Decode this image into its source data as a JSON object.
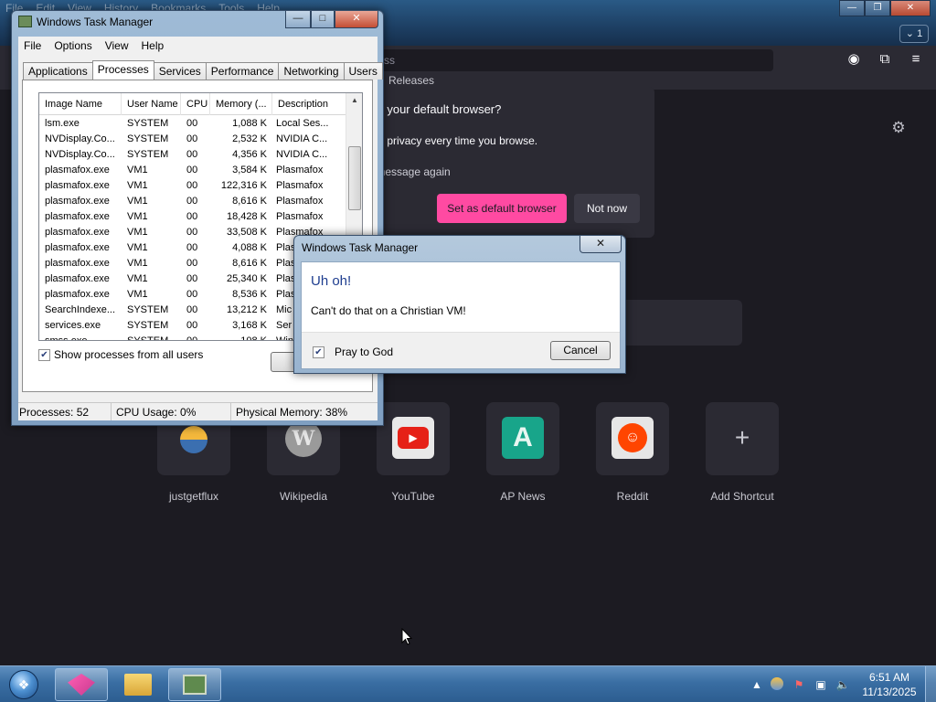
{
  "browser": {
    "menu": [
      "File",
      "Edit",
      "View",
      "History",
      "Bookmarks",
      "Tools",
      "Help"
    ],
    "tab_count": "1",
    "url_placeholder": "ss",
    "bookmark_releases": "Releases",
    "default_prompt": {
      "title": "ox your default browser?",
      "body": "and privacy every time you browse.",
      "dont_show": "s message again",
      "set_default_label": "Set as default browser",
      "not_now_label": "Not now"
    },
    "shortcuts": [
      {
        "label": "justgetflux",
        "icon": "flux-logo"
      },
      {
        "label": "Wikipedia",
        "icon": "wikipedia-globe"
      },
      {
        "label": "YouTube",
        "icon": "youtube-logo"
      },
      {
        "label": "AP News",
        "icon": "apnews-logo"
      },
      {
        "label": "Reddit",
        "icon": "reddit-logo"
      },
      {
        "label": "Add Shortcut",
        "icon": "plus-icon"
      }
    ],
    "accent_color": "#ff4aa2"
  },
  "taskmgr": {
    "title": "Windows Task Manager",
    "menu": [
      "File",
      "Options",
      "View",
      "Help"
    ],
    "tabs": [
      "Applications",
      "Processes",
      "Services",
      "Performance",
      "Networking",
      "Users"
    ],
    "active_tab": "Processes",
    "columns": [
      "Image Name",
      "User Name",
      "CPU",
      "Memory (...",
      "Description"
    ],
    "rows": [
      [
        "lsm.exe",
        "SYSTEM",
        "00",
        "1,088 K",
        "Local Ses..."
      ],
      [
        "NVDisplay.Co...",
        "SYSTEM",
        "00",
        "2,532 K",
        "NVIDIA C..."
      ],
      [
        "NVDisplay.Co...",
        "SYSTEM",
        "00",
        "4,356 K",
        "NVIDIA C..."
      ],
      [
        "plasmafox.exe",
        "VM1",
        "00",
        "3,584 K",
        "Plasmafox"
      ],
      [
        "plasmafox.exe",
        "VM1",
        "00",
        "122,316 K",
        "Plasmafox"
      ],
      [
        "plasmafox.exe",
        "VM1",
        "00",
        "8,616 K",
        "Plasmafox"
      ],
      [
        "plasmafox.exe",
        "VM1",
        "00",
        "18,428 K",
        "Plasmafox"
      ],
      [
        "plasmafox.exe",
        "VM1",
        "00",
        "33,508 K",
        "Plasmafox"
      ],
      [
        "plasmafox.exe",
        "VM1",
        "00",
        "4,088 K",
        "Plas"
      ],
      [
        "plasmafox.exe",
        "VM1",
        "00",
        "8,616 K",
        "Plas"
      ],
      [
        "plasmafox.exe",
        "VM1",
        "00",
        "25,340 K",
        "Plas"
      ],
      [
        "plasmafox.exe",
        "VM1",
        "00",
        "8,536 K",
        "Plas"
      ],
      [
        "SearchIndexe...",
        "SYSTEM",
        "00",
        "13,212 K",
        "Mic"
      ],
      [
        "services.exe",
        "SYSTEM",
        "00",
        "3,168 K",
        "Ser"
      ],
      [
        "smss.exe",
        "SYSTEM",
        "00",
        "108 K",
        "Win"
      ]
    ],
    "show_all_label": "Show processes from all users",
    "show_all_checked": true,
    "end_process_label": "En",
    "status": {
      "processes": "Processes: 52",
      "cpu": "CPU Usage: 0%",
      "memory": "Physical Memory: 38%"
    }
  },
  "dialog": {
    "title": "Windows Task Manager",
    "close_glyph": "✕",
    "heading": "Uh oh!",
    "message": "Can't do that on a Christian VM!",
    "checkbox_label": "Pray to God",
    "checkbox_checked": true,
    "cancel_label": "Cancel"
  },
  "taskbar": {
    "time": "6:51 AM",
    "date": "11/13/2025",
    "pinned": [
      "plasmafox-icon",
      "explorer-folder-icon",
      "task-manager-icon"
    ],
    "tray": [
      "show-hidden-arrow-icon",
      "weather-icon",
      "flag-icon",
      "network-icon",
      "volume-muted-icon"
    ]
  }
}
